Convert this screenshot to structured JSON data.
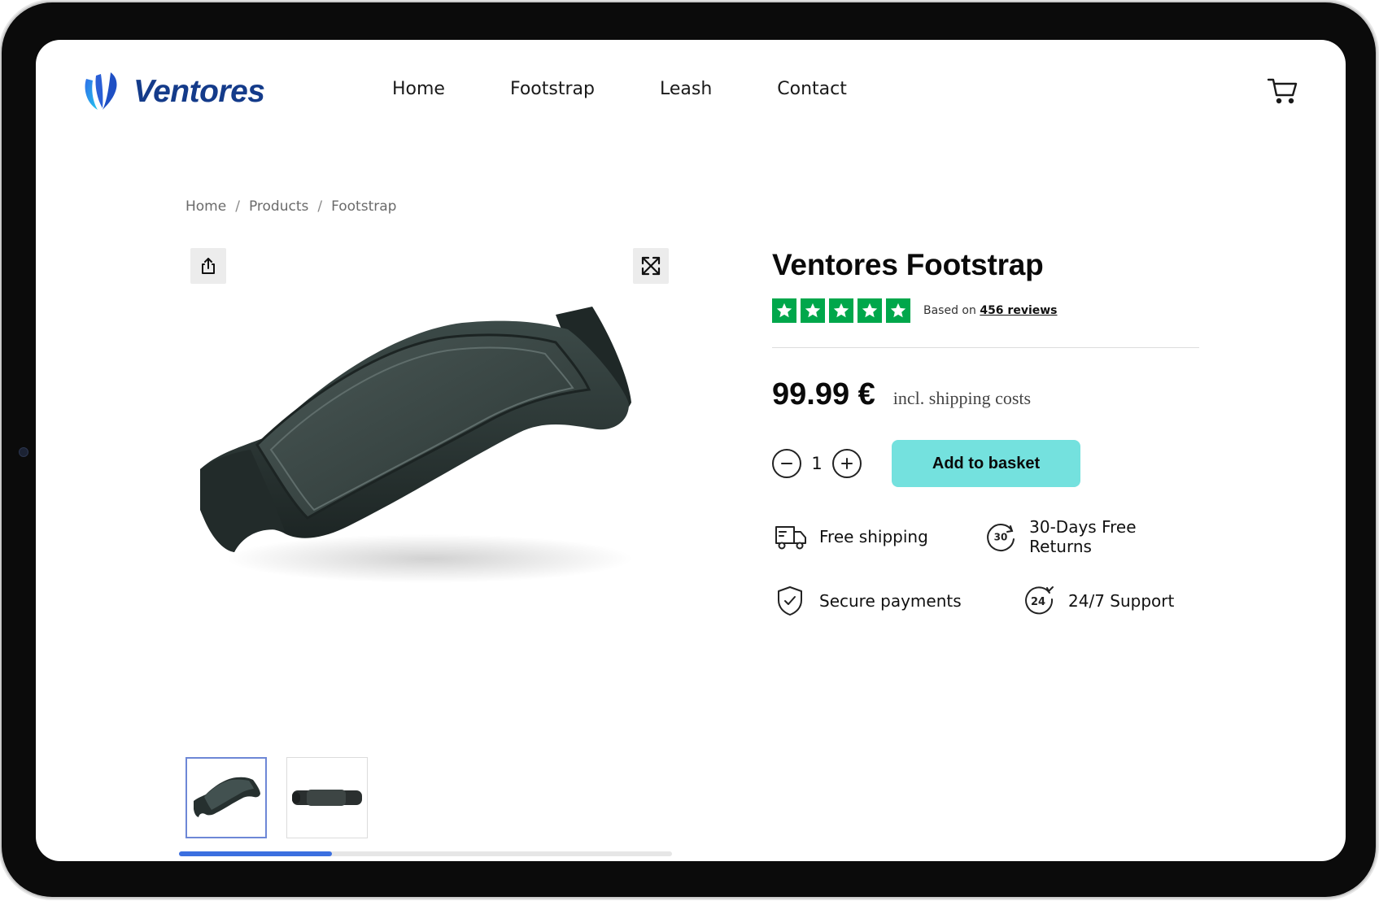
{
  "brand": {
    "name": "Ventores",
    "logo_icon": "ventores-v-logo",
    "text_color": "#143b8a",
    "gradient": [
      "#3b82f6",
      "#22c1ee"
    ]
  },
  "nav": {
    "items": [
      {
        "label": "Home"
      },
      {
        "label": "Footstrap"
      },
      {
        "label": "Leash"
      },
      {
        "label": "Contact"
      }
    ],
    "cart_icon": "shopping-cart-icon"
  },
  "breadcrumb": {
    "items": [
      "Home",
      "Products",
      "Footstrap"
    ],
    "separator": "/"
  },
  "gallery": {
    "share_icon": "share-icon",
    "expand_icon": "expand-icon",
    "main_image": "footstrap-product-photo",
    "thumbnails": [
      {
        "image": "footstrap-angle-view",
        "active": true
      },
      {
        "image": "footstrap-side-view",
        "active": false
      }
    ],
    "scroll_progress": 0.31,
    "accent": "#3b6fe0"
  },
  "product": {
    "title": "Ventores Footstrap",
    "rating": {
      "stars": 5,
      "star_color": "#00a74b",
      "prefix": "Based on",
      "reviews_link": "456 reviews"
    },
    "price": "99.99 €",
    "price_note": "incl. shipping costs",
    "quantity": "1",
    "add_button_label": "Add to basket",
    "add_button_color": "#74e1de",
    "features": [
      {
        "icon": "delivery-truck-icon",
        "label": "Free shipping"
      },
      {
        "icon": "30-day-return-icon",
        "label": "30-Days Free Returns",
        "icon_text": "30"
      },
      {
        "icon": "shield-check-icon",
        "label": "Secure payments"
      },
      {
        "icon": "24-7-support-icon",
        "label": "24/7 Support",
        "icon_text": "24"
      }
    ]
  }
}
